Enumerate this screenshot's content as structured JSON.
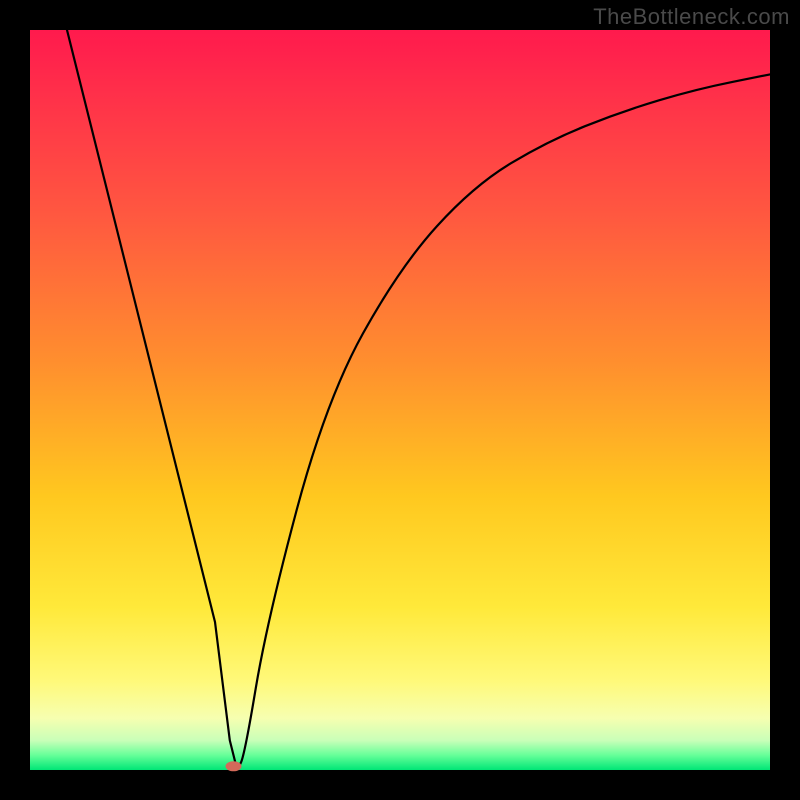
{
  "watermark": "TheBottleneck.com",
  "chart_data": {
    "type": "line",
    "title": "",
    "xlabel": "",
    "ylabel": "",
    "xlim": [
      0,
      100
    ],
    "ylim": [
      0,
      100
    ],
    "grid": false,
    "series": [
      {
        "name": "curve",
        "x": [
          5,
          10,
          15,
          20,
          25,
          27,
          28,
          29,
          32,
          40,
          50,
          60,
          70,
          80,
          90,
          100
        ],
        "values": [
          100,
          80,
          60,
          40,
          20,
          4,
          0,
          2,
          20,
          50,
          68,
          79,
          85,
          89,
          92,
          94
        ]
      }
    ],
    "markers": [
      {
        "name": "dot",
        "x": 27.5,
        "y": 0.5,
        "color": "#d46a5a"
      }
    ],
    "background_gradient": {
      "stops": [
        {
          "pos": 0,
          "color": "#ff1a4d"
        },
        {
          "pos": 25,
          "color": "#ff5840"
        },
        {
          "pos": 50,
          "color": "#ffb020"
        },
        {
          "pos": 78,
          "color": "#ffe93a"
        },
        {
          "pos": 93,
          "color": "#f6ffb0"
        },
        {
          "pos": 100,
          "color": "#00e676"
        }
      ]
    }
  }
}
